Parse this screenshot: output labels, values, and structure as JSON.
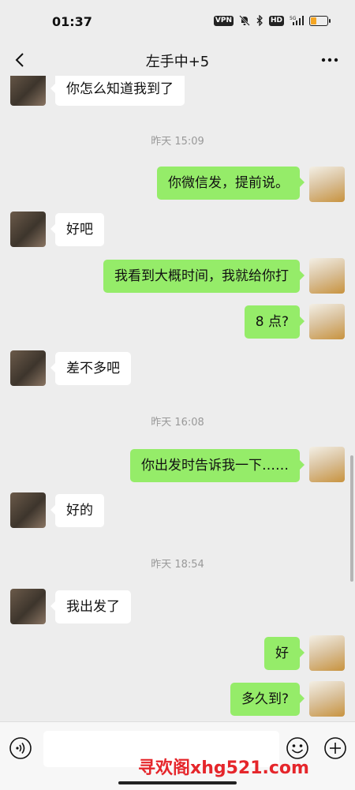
{
  "status_bar": {
    "time": "01:37",
    "vpn": "VPN",
    "hd": "HD",
    "network": "5G",
    "battery_level": 0.35
  },
  "header": {
    "title": "左手中+5"
  },
  "messages": [
    {
      "side": "left",
      "text": "你怎么知道我到了"
    },
    {
      "type": "time",
      "text": "昨天 15:09"
    },
    {
      "side": "right",
      "text": "你微信发，提前说。"
    },
    {
      "side": "left",
      "text": "好吧"
    },
    {
      "side": "right",
      "text": "我看到大概时间，我就给你打"
    },
    {
      "side": "right",
      "text": "8 点?"
    },
    {
      "side": "left",
      "text": "差不多吧"
    },
    {
      "type": "time",
      "text": "昨天 16:08"
    },
    {
      "side": "right",
      "text": "你出发时告诉我一下……"
    },
    {
      "side": "left",
      "text": "好的"
    },
    {
      "type": "time",
      "text": "昨天 18:54"
    },
    {
      "side": "left",
      "text": "我出发了"
    },
    {
      "side": "right",
      "text": "好"
    },
    {
      "side": "right",
      "text": "多久到?"
    }
  ],
  "input_bar": {
    "watermark": "寻欢阁xhg521.com"
  },
  "colors": {
    "background": "#ededed",
    "sent_bubble": "#95ec69",
    "received_bubble": "#ffffff",
    "watermark": "#e5262b"
  }
}
